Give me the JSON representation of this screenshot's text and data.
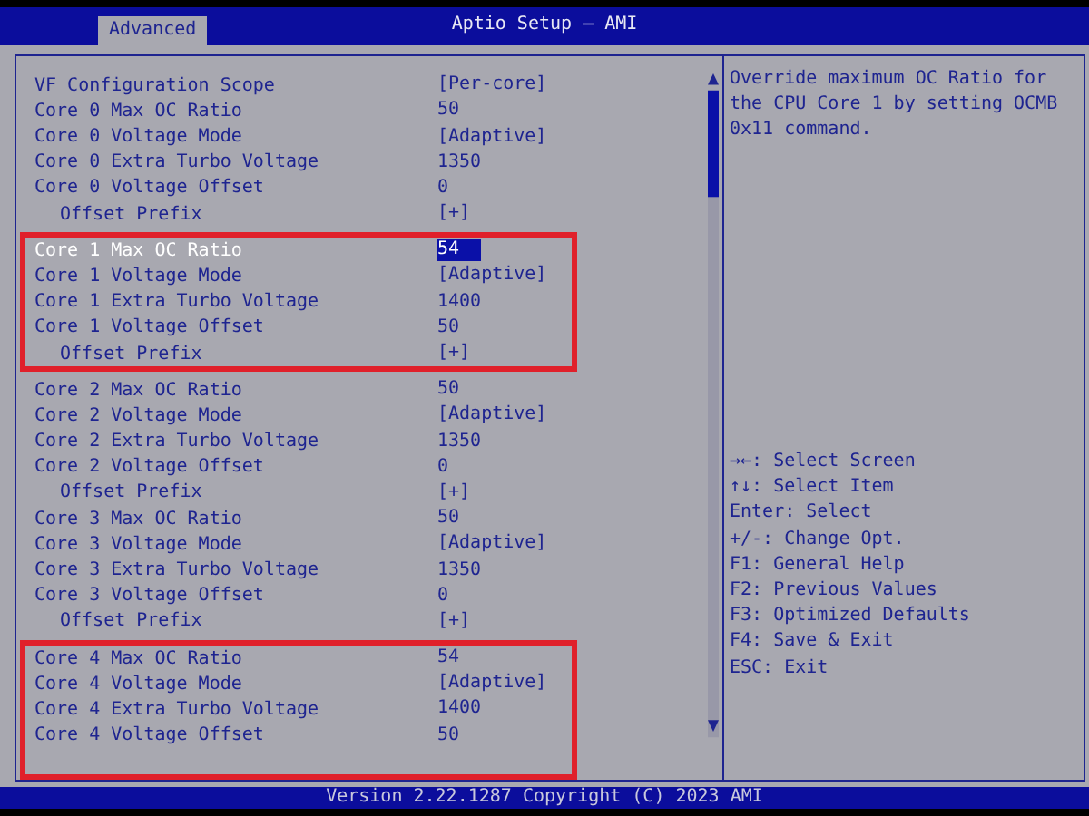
{
  "window": {
    "title": "Aptio Setup – AMI"
  },
  "tabs": [
    {
      "label": "Advanced",
      "selected": true
    }
  ],
  "sections": [
    {
      "highlighted": false,
      "rows": [
        {
          "kind": "item",
          "label": "VF Configuration Scope",
          "value": "[Per-core]",
          "selected": false
        },
        {
          "kind": "item",
          "label": "Core 0 Max OC Ratio",
          "value": "50",
          "selected": false
        },
        {
          "kind": "item",
          "label": "Core 0 Voltage Mode",
          "value": "[Adaptive]",
          "selected": false
        },
        {
          "kind": "item",
          "label": "Core 0 Extra Turbo Voltage",
          "value": "1350",
          "selected": false
        },
        {
          "kind": "item",
          "label": "Core 0 Voltage Offset",
          "value": "0",
          "selected": false
        },
        {
          "kind": "subitem",
          "label": "Offset Prefix",
          "value": "[+]",
          "selected": false
        }
      ]
    },
    {
      "highlighted": true,
      "rows": [
        {
          "kind": "item",
          "label": "Core 1 Max OC Ratio",
          "value": "54",
          "selected": true
        },
        {
          "kind": "item",
          "label": "Core 1 Voltage Mode",
          "value": "[Adaptive]",
          "selected": false
        },
        {
          "kind": "item",
          "label": "Core 1 Extra Turbo Voltage",
          "value": "1400",
          "selected": false
        },
        {
          "kind": "item",
          "label": "Core 1 Voltage Offset",
          "value": "50",
          "selected": false
        },
        {
          "kind": "subitem",
          "label": "Offset Prefix",
          "value": "[+]",
          "selected": false
        }
      ]
    },
    {
      "highlighted": false,
      "rows": [
        {
          "kind": "item",
          "label": "Core 2 Max OC Ratio",
          "value": "50",
          "selected": false
        },
        {
          "kind": "item",
          "label": "Core 2 Voltage Mode",
          "value": "[Adaptive]",
          "selected": false
        },
        {
          "kind": "item",
          "label": "Core 2 Extra Turbo Voltage",
          "value": "1350",
          "selected": false
        },
        {
          "kind": "item",
          "label": "Core 2 Voltage Offset",
          "value": "0",
          "selected": false
        },
        {
          "kind": "subitem",
          "label": "Offset Prefix",
          "value": "[+]",
          "selected": false
        },
        {
          "kind": "item",
          "label": "Core 3 Max OC Ratio",
          "value": "50",
          "selected": false
        },
        {
          "kind": "item",
          "label": "Core 3 Voltage Mode",
          "value": "[Adaptive]",
          "selected": false
        },
        {
          "kind": "item",
          "label": "Core 3 Extra Turbo Voltage",
          "value": "1350",
          "selected": false
        },
        {
          "kind": "item",
          "label": "Core 3 Voltage Offset",
          "value": "0",
          "selected": false
        },
        {
          "kind": "subitem",
          "label": "Offset Prefix",
          "value": "[+]",
          "selected": false
        }
      ]
    },
    {
      "highlighted": true,
      "rows": [
        {
          "kind": "item",
          "label": "Core 4 Max OC Ratio",
          "value": "54",
          "selected": false
        },
        {
          "kind": "item",
          "label": "Core 4 Voltage Mode",
          "value": "[Adaptive]",
          "selected": false
        },
        {
          "kind": "item",
          "label": "Core 4 Extra Turbo Voltage",
          "value": "1400",
          "selected": false
        },
        {
          "kind": "item",
          "label": "Core 4 Voltage Offset",
          "value": "50",
          "selected": false
        }
      ]
    }
  ],
  "help_text": "Override maximum OC Ratio for the CPU Core 1 by setting OCMB 0x11 command.",
  "key_help": [
    "→←: Select Screen",
    "↑↓: Select Item",
    "Enter: Select",
    "+/-: Change Opt.",
    "F1: General Help",
    "F2: Previous Values",
    "F3: Optimized Defaults",
    "F4: Save & Exit",
    "ESC: Exit"
  ],
  "status_bar": "Version 2.22.1287 Copyright (C) 2023 AMI"
}
